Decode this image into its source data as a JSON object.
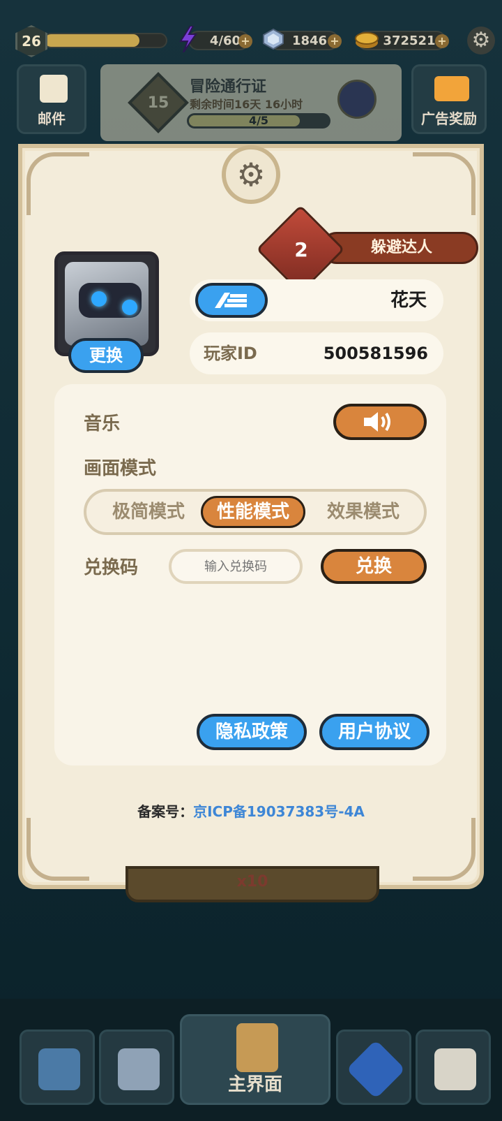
{
  "top_bar": {
    "level": "26",
    "xp_fraction": 0.78,
    "energy": "4/60",
    "gems": "1846",
    "coins": "372521",
    "icons": [
      "lightning-icon",
      "gem-icon",
      "coin-icon",
      "gear-icon"
    ]
  },
  "side_buttons": {
    "mail_label": "邮件",
    "ad_reward_label": "广告奖励"
  },
  "pass": {
    "title": "冒险通行证",
    "remaining": "剩余时间16天 16小时",
    "progress": "4/5",
    "progress_fraction": 0.8,
    "level": "15"
  },
  "profile": {
    "title_badge_num": "2",
    "title_badge_text": "躲避达人",
    "change_avatar_label": "更换",
    "player_name": "花天",
    "player_id_label": "玩家ID",
    "player_id": "500581596"
  },
  "settings": {
    "music_label": "音乐",
    "display_mode_label": "画面模式",
    "modes": [
      "极简模式",
      "性能模式",
      "效果模式"
    ],
    "active_mode": "性能模式",
    "redeem_label": "兑换码",
    "redeem_placeholder": "输入兑换码",
    "redeem_button": "兑换",
    "privacy_button": "隐私政策",
    "agreement_button": "用户协议"
  },
  "footer": {
    "icp_label": "备案号：",
    "icp_value": "京ICP备19037383号-4A"
  },
  "behind": {
    "cost": "x10"
  },
  "nav": {
    "main_label": "主界面"
  },
  "colors": {
    "accent_orange": "#d9853d",
    "accent_blue": "#3aa1ef",
    "dialog_bg": "#f3ecda",
    "link_blue": "#3d86d6"
  }
}
